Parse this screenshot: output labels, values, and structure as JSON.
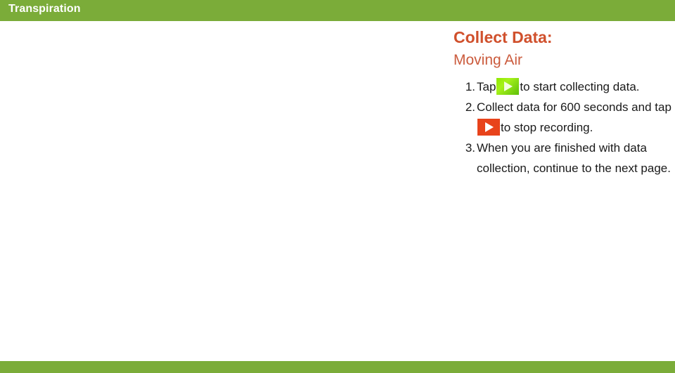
{
  "header": {
    "title": "Transpiration",
    "bar_color": "#7BAC39",
    "title_color": "#FFFFFF"
  },
  "footer": {
    "bar_color": "#7BAC39"
  },
  "content": {
    "title": "Collect Data:",
    "title_color": "#D0502C",
    "subtitle": "Moving Air",
    "subtitle_color": "#CB5B3D",
    "steps": [
      {
        "number": "1.",
        "text_before": "Tap",
        "icon": "play-icon-green",
        "icon_color": "#8FE800",
        "text_after": "to start collecting data."
      },
      {
        "number": "2.",
        "text_before": "Collect data for 600 seconds and tap",
        "icon": "play-icon-red",
        "icon_color": "#E8431B",
        "text_after": "to stop recording."
      },
      {
        "number": "3.",
        "text_before": "When you are finished with data collection, continue to the next page.",
        "icon": null,
        "icon_color": null,
        "text_after": null
      }
    ]
  }
}
